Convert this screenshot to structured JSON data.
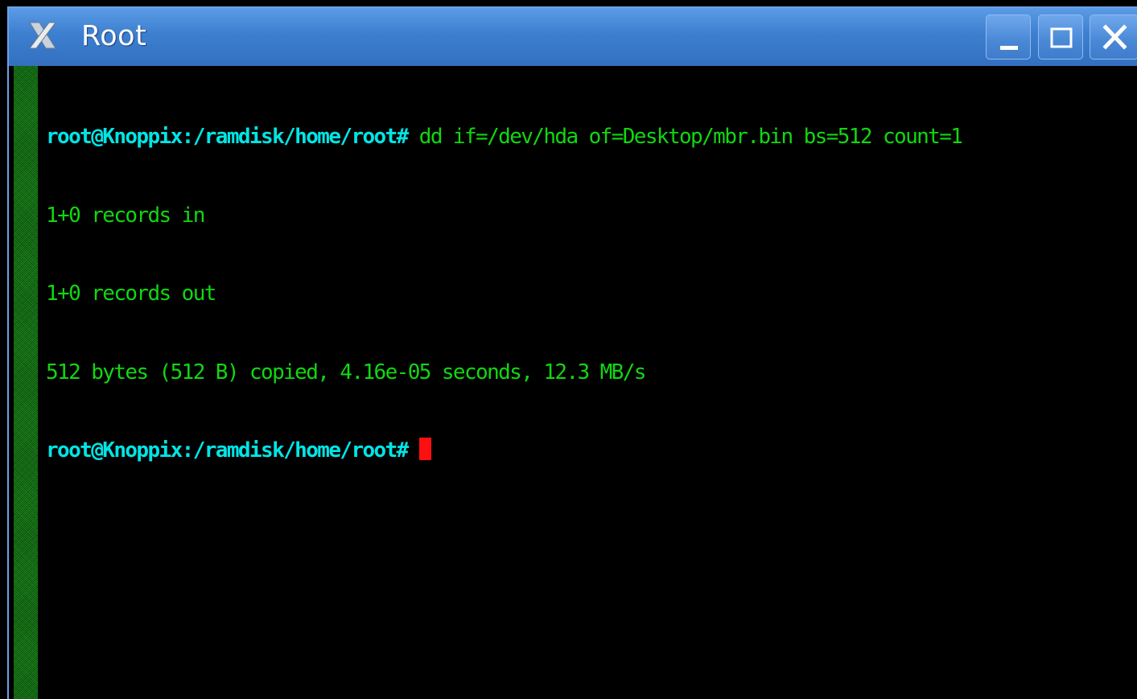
{
  "window": {
    "title": "Root",
    "app_icon": "x-window-icon",
    "buttons": {
      "minimize_icon": "minimize-icon",
      "maximize_icon": "maximize-icon",
      "close_icon": "close-icon"
    }
  },
  "terminal": {
    "prompt": "root@Knoppix:/ramdisk/home/root#",
    "command": " dd if=/dev/hda of=Desktop/mbr.bin bs=512 count=1",
    "output": [
      "1+0 records in",
      "1+0 records out",
      "512 bytes (512 B) copied, 4.16e-05 seconds, 12.3 MB/s"
    ],
    "current_prompt": "root@Knoppix:/ramdisk/home/root#"
  },
  "colors": {
    "prompt": "#00e5e5",
    "text": "#10d810",
    "cursor": "#ff1010",
    "titlebar": "#3d7fcf",
    "scrollbar": "#1f9a1f"
  }
}
